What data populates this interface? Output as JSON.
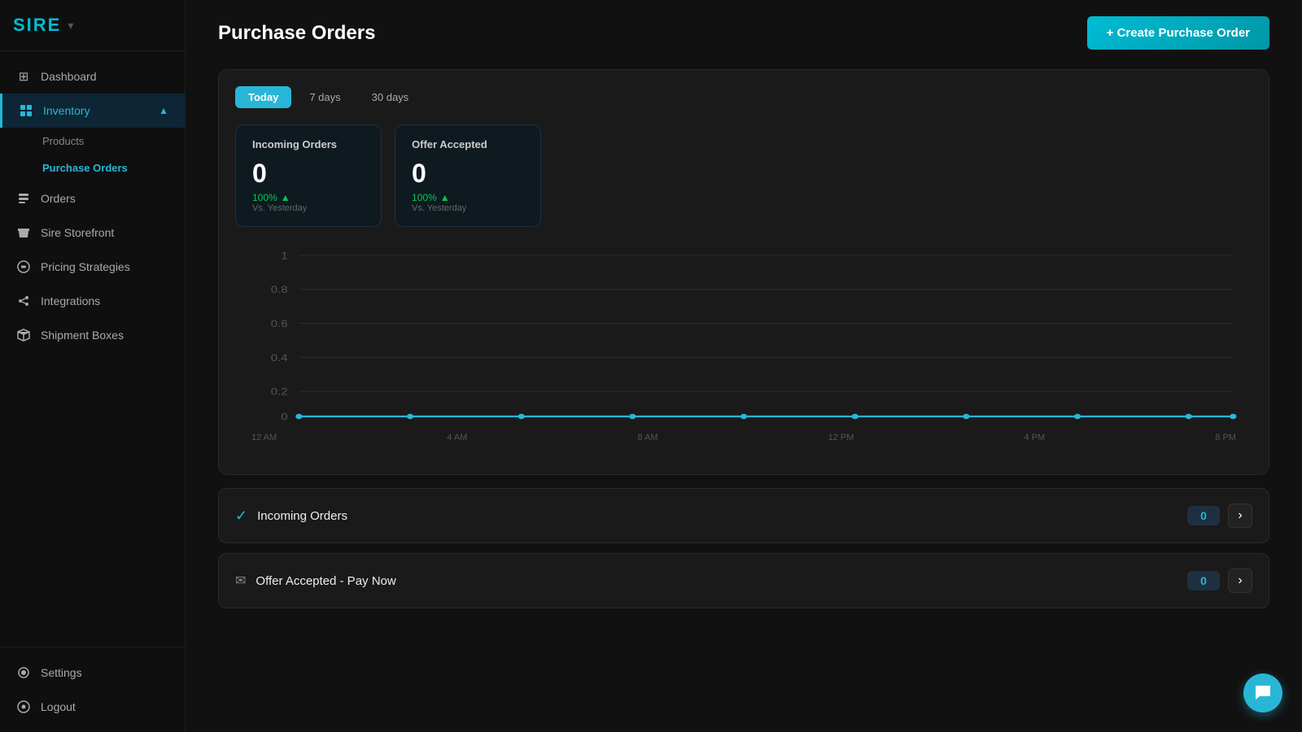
{
  "logo": {
    "text": "SIRE",
    "chevron": "▾"
  },
  "sidebar": {
    "items": [
      {
        "id": "dashboard",
        "label": "Dashboard",
        "icon": "⊞",
        "active": false,
        "indent": false
      },
      {
        "id": "inventory",
        "label": "Inventory",
        "icon": "📦",
        "active": true,
        "indent": false
      },
      {
        "id": "orders",
        "label": "Orders",
        "icon": "📋",
        "active": false,
        "indent": false
      },
      {
        "id": "sire-storefront",
        "label": "Sire Storefront",
        "icon": "🏪",
        "active": false,
        "indent": false
      },
      {
        "id": "pricing-strategies",
        "label": "Pricing Strategies",
        "icon": "⚙",
        "active": false,
        "indent": false
      },
      {
        "id": "integrations",
        "label": "Integrations",
        "icon": "🔗",
        "active": false,
        "indent": false
      },
      {
        "id": "shipment-boxes",
        "label": "Shipment Boxes",
        "icon": "📦",
        "active": false,
        "indent": false
      }
    ],
    "sub_items": [
      {
        "id": "products",
        "label": "Products",
        "active": false
      },
      {
        "id": "purchase-orders",
        "label": "Purchase Orders",
        "active": true
      }
    ],
    "bottom_items": [
      {
        "id": "settings",
        "label": "Settings",
        "icon": "👤"
      },
      {
        "id": "logout",
        "label": "Logout",
        "icon": "⭕"
      }
    ]
  },
  "page": {
    "title": "Purchase Orders",
    "create_btn": "+ Create Purchase Order"
  },
  "tabs": [
    {
      "id": "today",
      "label": "Today",
      "active": true
    },
    {
      "id": "7days",
      "label": "7 days",
      "active": false
    },
    {
      "id": "30days",
      "label": "30 days",
      "active": false
    }
  ],
  "metrics": [
    {
      "title": "Incoming Orders",
      "value": "0",
      "change": "100%",
      "vs_text": "Vs. Yesterday"
    },
    {
      "title": "Offer Accepted",
      "value": "0",
      "change": "100%",
      "vs_text": "Vs. Yesterday"
    }
  ],
  "chart": {
    "y_labels": [
      "1",
      "0.8",
      "0.6",
      "0.4",
      "0.2",
      "0"
    ],
    "x_labels": [
      "12 AM",
      "4 AM",
      "8 AM",
      "12 PM",
      "4 PM",
      "8 PM"
    ]
  },
  "list_items": [
    {
      "id": "incoming-orders",
      "icon": "✓",
      "title": "Incoming Orders",
      "count": "0"
    },
    {
      "id": "offer-accepted",
      "icon": "✉",
      "title": "Offer Accepted - Pay Now",
      "count": "0"
    }
  ]
}
